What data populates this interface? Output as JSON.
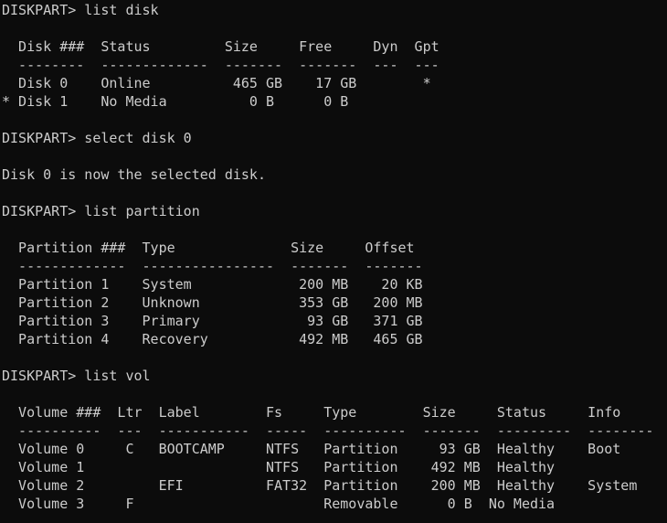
{
  "colors": {
    "background": "#0c0c0c",
    "text": "#cccccc"
  },
  "console": {
    "lines": [
      "DISKPART> list disk",
      "",
      "  Disk ###  Status         Size     Free     Dyn  Gpt",
      "  --------  -------------  -------  -------  ---  ---",
      "  Disk 0    Online          465 GB    17 GB        *",
      "* Disk 1    No Media          0 B      0 B",
      "",
      "DISKPART> select disk 0",
      "",
      "Disk 0 is now the selected disk.",
      "",
      "DISKPART> list partition",
      "",
      "  Partition ###  Type              Size     Offset",
      "  -------------  ----------------  -------  -------",
      "  Partition 1    System             200 MB    20 KB",
      "  Partition 2    Unknown            353 GB   200 MB",
      "  Partition 3    Primary             93 GB   371 GB",
      "  Partition 4    Recovery           492 MB   465 GB",
      "",
      "DISKPART> list vol",
      "",
      "  Volume ###  Ltr  Label        Fs     Type        Size     Status     Info",
      "  ----------  ---  -----------  -----  ----------  -------  ---------  --------",
      "  Volume 0     C   BOOTCAMP     NTFS   Partition     93 GB  Healthy    Boot",
      "  Volume 1                      NTFS   Partition    492 MB  Healthy",
      "  Volume 2         EFI          FAT32  Partition    200 MB  Healthy    System",
      "  Volume 3     F                       Removable      0 B  No Media"
    ]
  }
}
